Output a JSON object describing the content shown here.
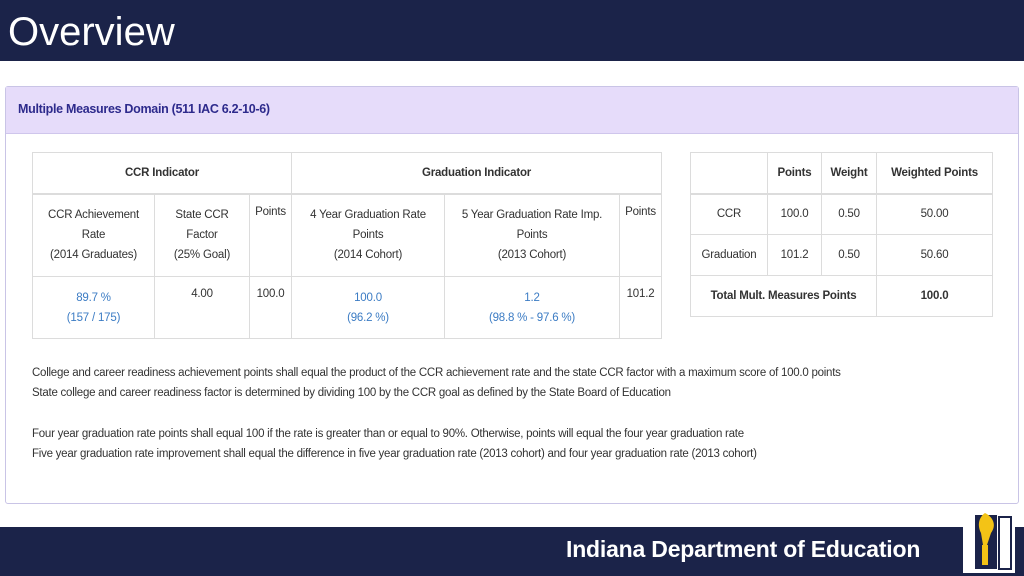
{
  "slide": {
    "title": "Overview",
    "footer_org": "Indiana Department of Education"
  },
  "panel": {
    "title": "Multiple Measures Domain (511 IAC 6.2-10-6)"
  },
  "indicators_table": {
    "group_headers": {
      "ccr": "CCR Indicator",
      "graduation": "Graduation Indicator"
    },
    "columns": {
      "ccr_rate": [
        "CCR Achievement",
        "Rate",
        "(2014 Graduates)"
      ],
      "state_factor": [
        "State CCR",
        "Factor",
        "(25% Goal)"
      ],
      "ccr_points": "Points",
      "grad4": [
        "4 Year Graduation Rate",
        "Points",
        "(2014 Cohort)"
      ],
      "grad5": [
        "5 Year Graduation Rate Imp.",
        "Points",
        "(2013 Cohort)"
      ],
      "grad_points": "Points"
    },
    "row": {
      "ccr_rate": [
        "89.7 %",
        "(157 / 175)"
      ],
      "state_factor": "4.00",
      "ccr_points": "100.0",
      "grad4": [
        "100.0",
        "(96.2 %)"
      ],
      "grad5": [
        "1.2",
        "(98.8 % - 97.6 %)"
      ],
      "grad_points": "101.2"
    }
  },
  "summary_table": {
    "headers": [
      "",
      "Points",
      "Weight",
      "Weighted Points"
    ],
    "rows": [
      {
        "label": "CCR",
        "points": "100.0",
        "weight": "0.50",
        "weighted": "50.00"
      },
      {
        "label": "Graduation",
        "points": "101.2",
        "weight": "0.50",
        "weighted": "50.60"
      }
    ],
    "total": {
      "label": "Total Mult. Measures Points",
      "value": "100.0"
    }
  },
  "notes": [
    "College and career readiness achievement points shall equal the product of the CCR achievement rate and the state CCR factor with a maximum score of 100.0 points",
    "State college and career readiness factor is determined by dividing 100 by the CCR goal as defined by the State Board of Education",
    "Four year graduation rate points shall equal 100 if the rate is greater than or equal to 90%. Otherwise, points will equal the four year graduation rate",
    "Five year graduation rate improvement shall equal the difference in five year graduation rate (2013 cohort) and four year graduation rate (2013 cohort)"
  ],
  "icons": {
    "logo": "indiana-torch-logo-icon"
  },
  "colors": {
    "bar": "#1b2349",
    "panel_header": "#e6dcfa",
    "panel_title": "#2d2a8c",
    "link_blue": "#3c7cc4",
    "logo_gold": "#f3c316"
  }
}
